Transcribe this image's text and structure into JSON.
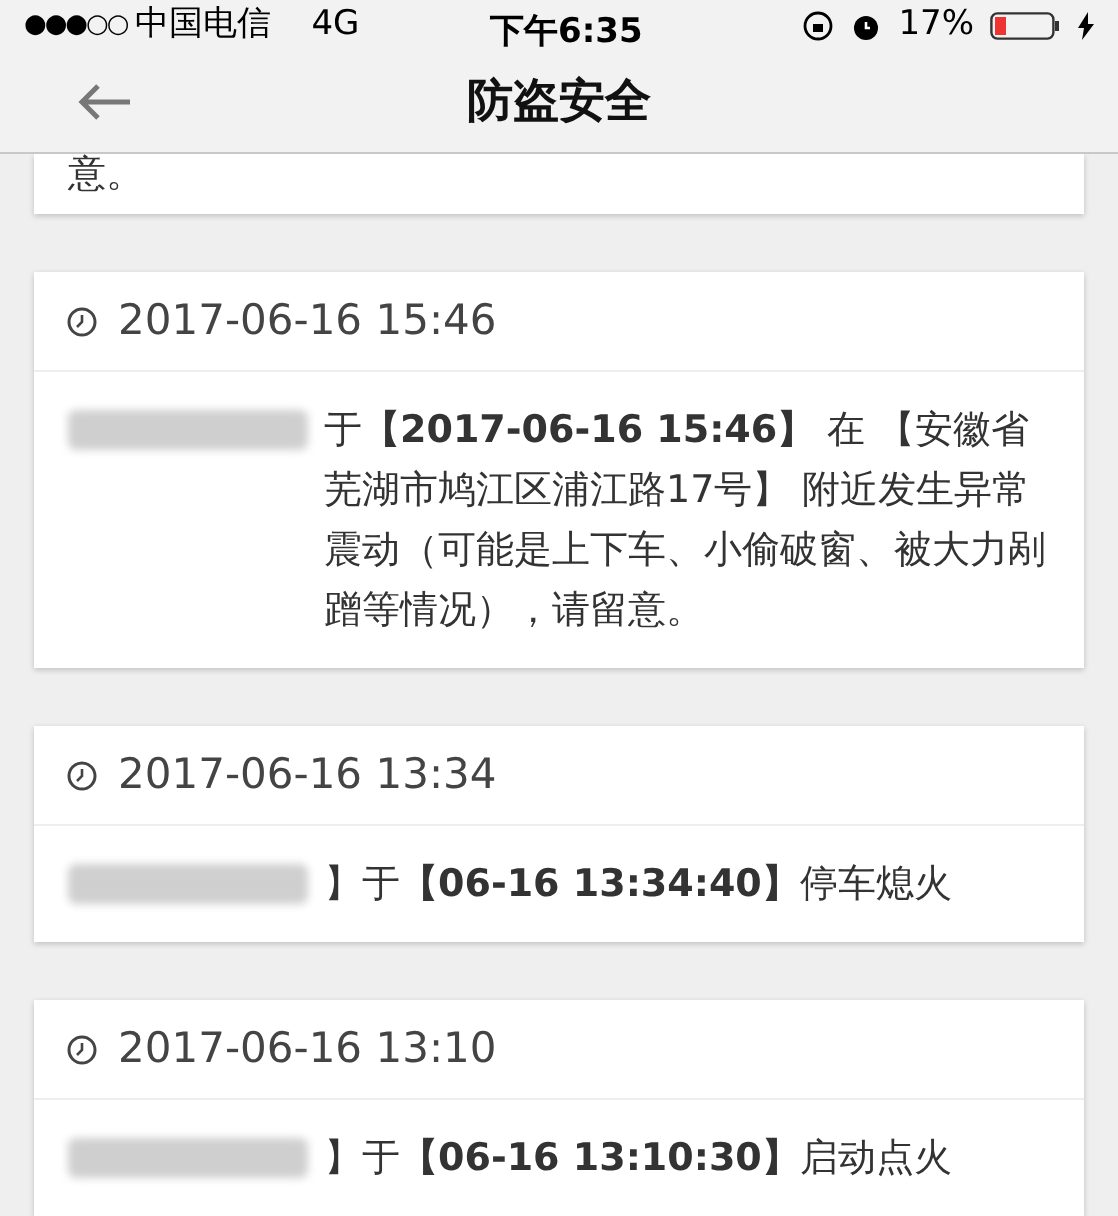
{
  "status_bar": {
    "signal": "●●●○○",
    "carrier": "中国电信",
    "network": "4G",
    "time": "下午6:35",
    "battery": "17%"
  },
  "nav": {
    "title": "防盗安全"
  },
  "partial_card": {
    "text": "意。"
  },
  "events": [
    {
      "time": "2017-06-16 15:46",
      "message": "于**【2017-06-16 15:46】** 在 【安徽省芜湖市鸠江区浦江路17号】 附近发生异常震动（可能是上下车、小偷破窗、被大力剐蹭等情况），请留意。"
    },
    {
      "time": "2017-06-16 13:34",
      "message": "】于**【06-16 13:34:40】**停车熄火"
    },
    {
      "time": "2017-06-16 13:10",
      "message": "】于**【06-16 13:10:30】**启动点火"
    }
  ]
}
